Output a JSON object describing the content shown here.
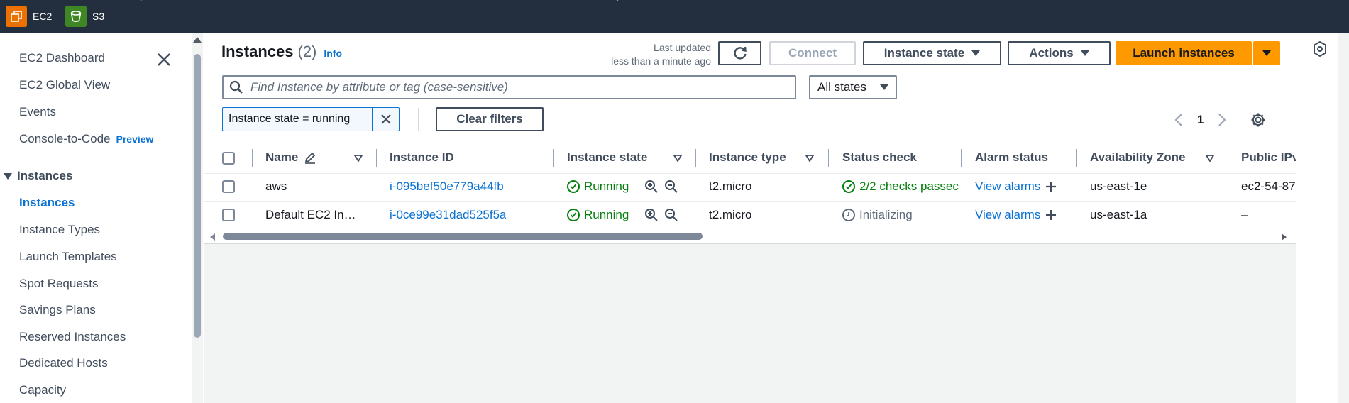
{
  "topbar": {
    "services": [
      {
        "label": "EC2",
        "icon": "ec2-icon",
        "color": "#ed7100"
      },
      {
        "label": "S3",
        "icon": "s3-bucket-icon",
        "color": "#3f8624"
      }
    ]
  },
  "sidebar": {
    "items": [
      {
        "label": "EC2 Dashboard"
      },
      {
        "label": "EC2 Global View"
      },
      {
        "label": "Events"
      },
      {
        "label": "Console-to-Code",
        "badge": "Preview"
      }
    ],
    "section_title": "Instances",
    "section_items": [
      {
        "label": "Instances",
        "active": true
      },
      {
        "label": "Instance Types"
      },
      {
        "label": "Launch Templates"
      },
      {
        "label": "Spot Requests"
      },
      {
        "label": "Savings Plans"
      },
      {
        "label": "Reserved Instances"
      },
      {
        "label": "Dedicated Hosts"
      },
      {
        "label": "Capacity"
      }
    ]
  },
  "header": {
    "title": "Instances",
    "count": "(2)",
    "info_link": "Info",
    "last_updated_label": "Last updated",
    "last_updated_value": "less than a minute ago"
  },
  "toolbar": {
    "connect_label": "Connect",
    "instance_state_label": "Instance state",
    "actions_label": "Actions",
    "launch_label": "Launch instances"
  },
  "filter": {
    "search_placeholder": "Find Instance by attribute or tag (case-sensitive)",
    "states_select": "All states",
    "token": "Instance state = running",
    "clear_filters_label": "Clear filters"
  },
  "pagination": {
    "page": "1"
  },
  "table": {
    "columns": [
      "Name",
      "Instance ID",
      "Instance state",
      "Instance type",
      "Status check",
      "Alarm status",
      "Availability Zone",
      "Public IPv"
    ],
    "rows": [
      {
        "name": "aws",
        "instance_id": "i-095bef50e779a44fb",
        "state": "Running",
        "type": "t2.micro",
        "status_check": "2/2 checks passec",
        "alarm": "View alarms",
        "az": "us-east-1e",
        "public_ip": "ec2-54-87"
      },
      {
        "name": "Default EC2 In…",
        "instance_id": "i-0ce99e31dad525f5a",
        "state": "Running",
        "type": "t2.micro",
        "status_check": "Initializing",
        "alarm": "View alarms",
        "az": "us-east-1a",
        "public_ip": "–"
      }
    ]
  },
  "colors": {
    "accent": "#0972d3",
    "primary_button": "#ff9900",
    "success": "#037f0c",
    "topbar": "#232f3e"
  }
}
